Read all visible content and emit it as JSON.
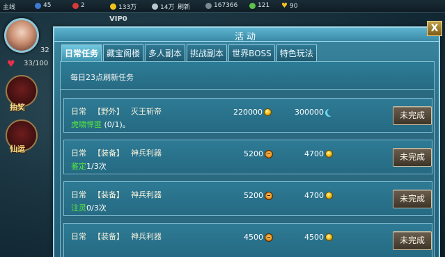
{
  "hud": {
    "left_label": "主线",
    "stat1": "45",
    "stat2": "2",
    "stat3": "133万",
    "stat4": "14万",
    "stat5": "167366",
    "stat6": "121",
    "stat7": "90",
    "refresh_label": "刷新",
    "vip": "VIP0",
    "level": "32",
    "hp": "33/100",
    "side_btn1": "抽奖",
    "side_btn2": "仙运",
    "close_label": "X"
  },
  "panel": {
    "title": "活动",
    "tabs": [
      {
        "label": "日常任务",
        "active": true
      },
      {
        "label": "藏宝阁楼",
        "active": false
      },
      {
        "label": "多人副本",
        "active": false
      },
      {
        "label": "挑战副本",
        "active": false
      },
      {
        "label": "世界BOSS",
        "active": false
      },
      {
        "label": "特色玩法",
        "active": false
      }
    ],
    "refresh_notice": "每日23点刷新任务"
  },
  "tasks": [
    {
      "type": "日常",
      "category": "【野外】",
      "name": "灭王斩帝",
      "progress_label": "虎啸悍匪",
      "progress_count": "(0/1)。",
      "reward1": "220000",
      "reward1_icon": "coin-icon",
      "reward2": "300000",
      "reward2_icon": "moon-icon",
      "status": "未完成"
    },
    {
      "type": "日常",
      "category": "【装备】",
      "name": "神兵利器",
      "progress_label": "鉴定",
      "progress_count": "1/3次",
      "reward1": "5200",
      "reward1_icon": "face-icon",
      "reward2": "4700",
      "reward2_icon": "coin-icon",
      "status": "未完成"
    },
    {
      "type": "日常",
      "category": "【装备】",
      "name": "神兵利器",
      "progress_label": "注灵",
      "progress_count": "0/3次",
      "reward1": "5200",
      "reward1_icon": "face-icon",
      "reward2": "4700",
      "reward2_icon": "coin-icon",
      "status": "未完成"
    },
    {
      "type": "日常",
      "category": "【装备】",
      "name": "神兵利器",
      "progress_label": "",
      "progress_count": "",
      "reward1": "4500",
      "reward1_icon": "face-icon",
      "reward2": "4500",
      "reward2_icon": "coin-icon",
      "status": "未完成"
    }
  ],
  "colors": {
    "progress_green": "#57e83f",
    "panel_border": "#9ed6e8",
    "accent_gold": "#f2c21c"
  }
}
